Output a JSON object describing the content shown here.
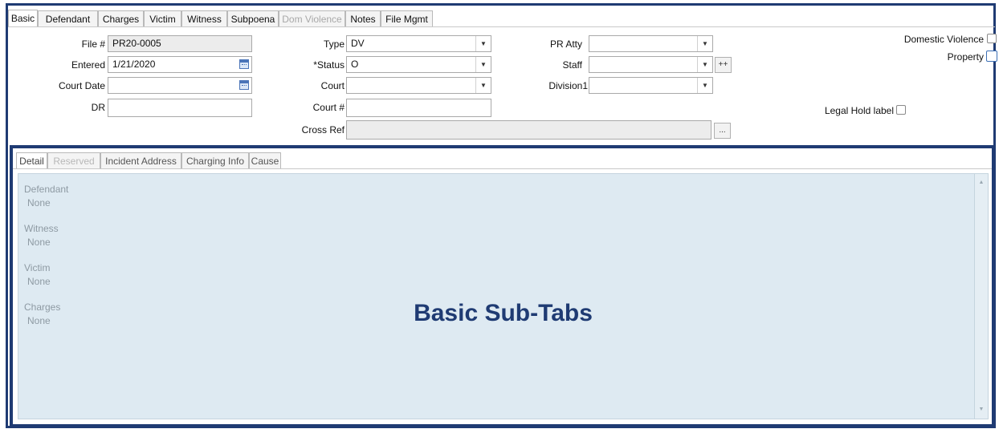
{
  "top_tabs": {
    "basic": "Basic",
    "defendant": "Defendant",
    "charges": "Charges",
    "victim": "Victim",
    "witness": "Witness",
    "subpoena": "Subpoena",
    "dom_violence": "Dom Violence",
    "notes": "Notes",
    "file_mgmt": "File Mgmt"
  },
  "form": {
    "file_no": {
      "label": "File #",
      "value": "PR20-0005"
    },
    "entered": {
      "label": "Entered",
      "value": "1/21/2020"
    },
    "court_date": {
      "label": "Court Date",
      "value": ""
    },
    "dr": {
      "label": "DR",
      "value": ""
    },
    "type": {
      "label": "Type",
      "value": "DV"
    },
    "status": {
      "label": "*Status",
      "value": "O"
    },
    "court": {
      "label": "Court",
      "value": ""
    },
    "court_no": {
      "label": "Court #",
      "value": ""
    },
    "cross_ref": {
      "label": "Cross Ref",
      "value": "",
      "button": "..."
    },
    "pr_atty": {
      "label": "PR Atty",
      "value": ""
    },
    "staff": {
      "label": "Staff",
      "value": "",
      "button": "++"
    },
    "division1": {
      "label": "Division1",
      "value": ""
    },
    "domestic_violence": {
      "label": "Domestic Violence",
      "checked": false
    },
    "property": {
      "label": "Property",
      "checked": false
    },
    "legal_hold": {
      "label": "Legal Hold label",
      "checked": false
    }
  },
  "sub_tabs": {
    "detail": "Detail",
    "reserved": "Reserved",
    "incident_address": "Incident Address",
    "charging_info": "Charging Info",
    "cause": "Cause"
  },
  "detail": {
    "defendant": {
      "label": "Defendant",
      "value": "None"
    },
    "witness": {
      "label": "Witness",
      "value": "None"
    },
    "victim": {
      "label": "Victim",
      "value": "None"
    },
    "charges": {
      "label": "Charges",
      "value": "None"
    }
  },
  "annotation": "Basic Sub-Tabs"
}
